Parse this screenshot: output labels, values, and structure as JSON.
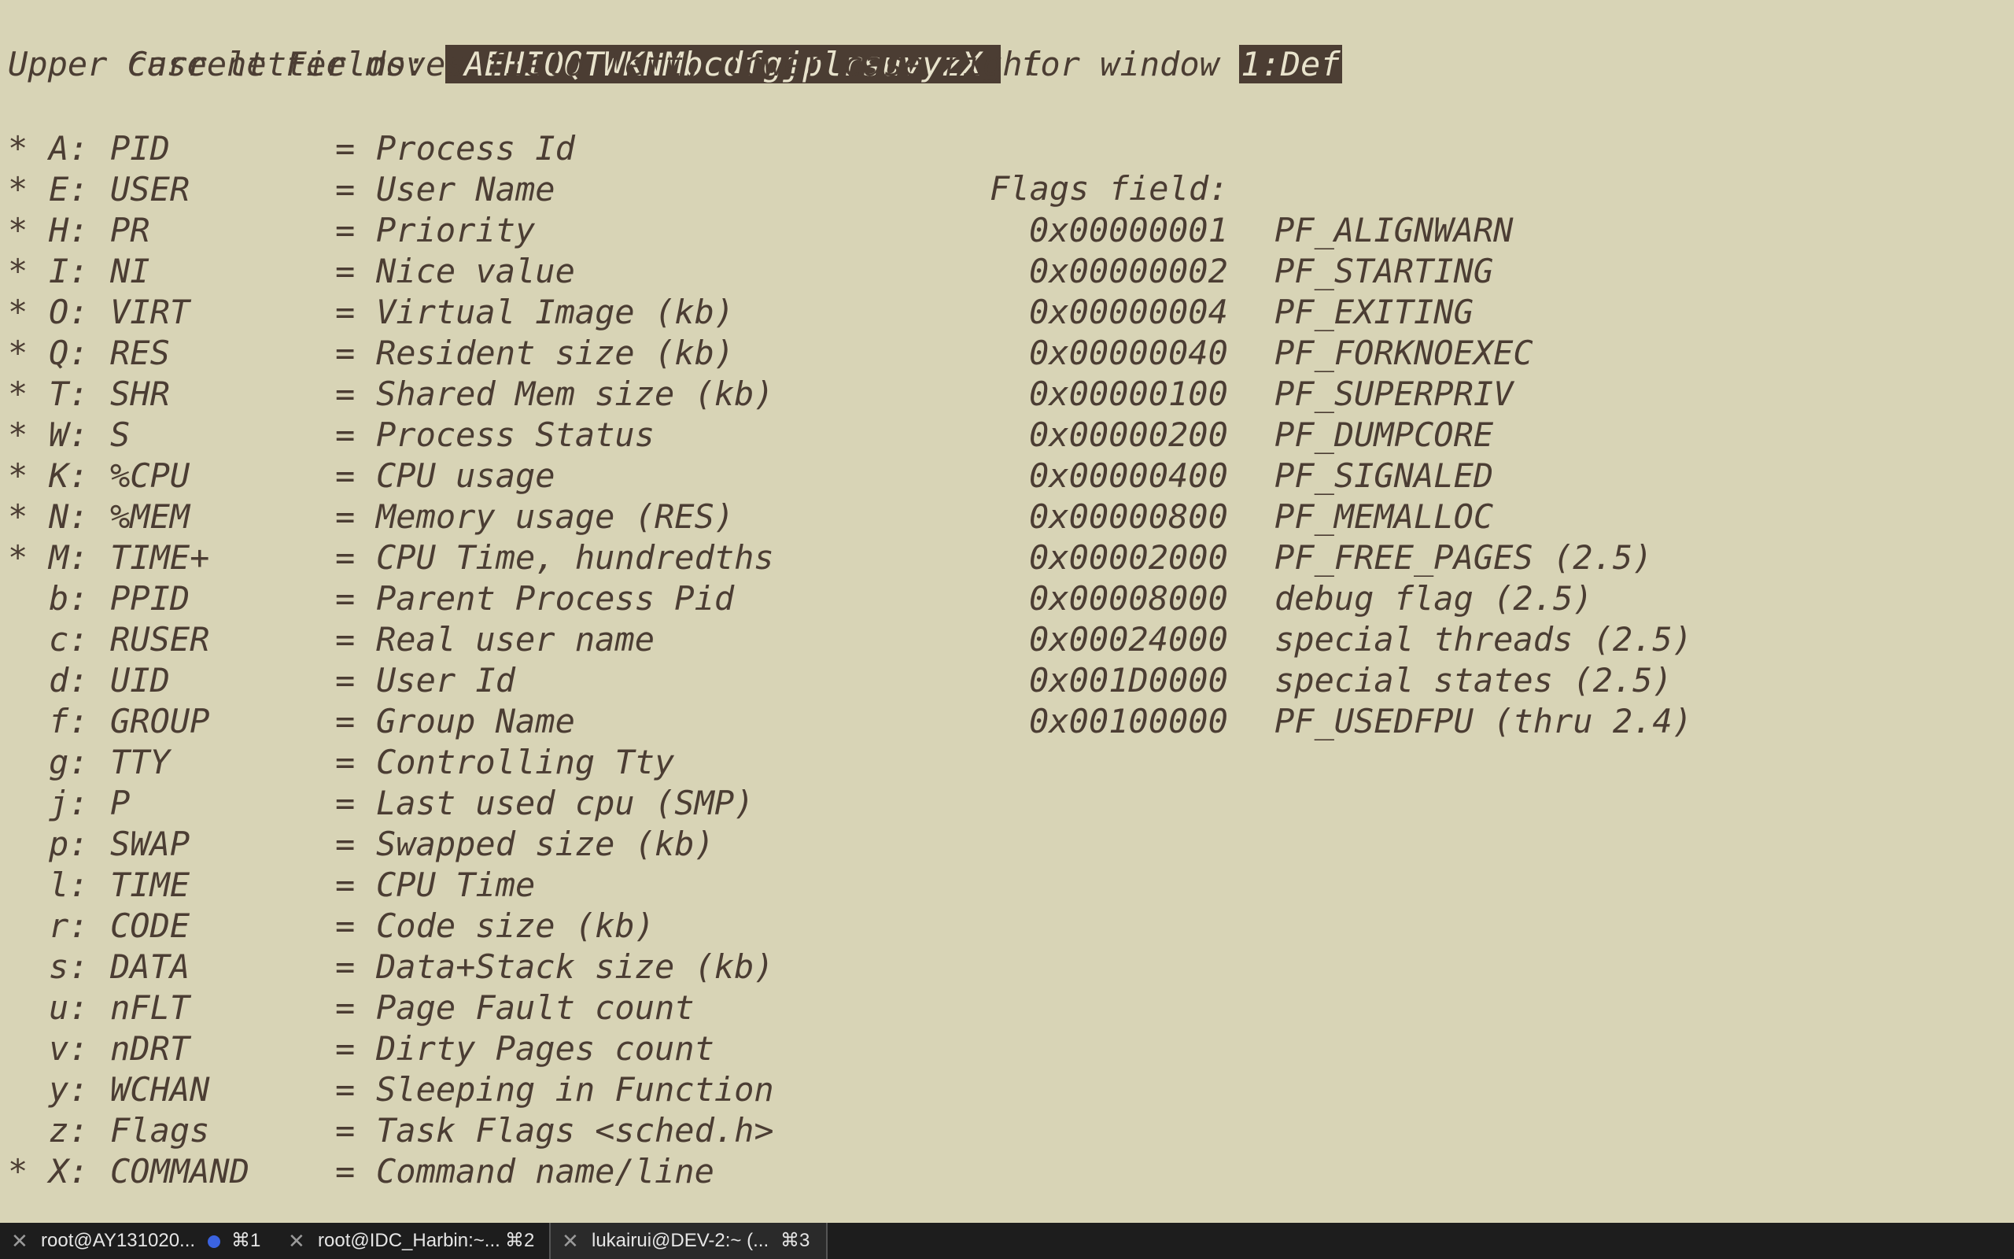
{
  "header": {
    "prefix": "Current Fields: ",
    "fields": "AEHIOQTWKNMbcdfgjplrsuvyzX",
    "middle": " for window ",
    "window": "1:Def",
    "help": "Upper case letter moves field left, lower case right"
  },
  "fields": [
    {
      "star": "*",
      "key": "A:",
      "name": "PID",
      "desc": "Process Id"
    },
    {
      "star": "*",
      "key": "E:",
      "name": "USER",
      "desc": "User Name"
    },
    {
      "star": "*",
      "key": "H:",
      "name": "PR",
      "desc": "Priority"
    },
    {
      "star": "*",
      "key": "I:",
      "name": "NI",
      "desc": "Nice value"
    },
    {
      "star": "*",
      "key": "O:",
      "name": "VIRT",
      "desc": "Virtual Image (kb)"
    },
    {
      "star": "*",
      "key": "Q:",
      "name": "RES",
      "desc": "Resident size (kb)"
    },
    {
      "star": "*",
      "key": "T:",
      "name": "SHR",
      "desc": "Shared Mem size (kb)"
    },
    {
      "star": "*",
      "key": "W:",
      "name": "S",
      "desc": "Process Status"
    },
    {
      "star": "*",
      "key": "K:",
      "name": "%CPU",
      "desc": "CPU usage"
    },
    {
      "star": "*",
      "key": "N:",
      "name": "%MEM",
      "desc": "Memory usage (RES)"
    },
    {
      "star": "*",
      "key": "M:",
      "name": "TIME+",
      "desc": "CPU Time, hundredths"
    },
    {
      "star": "",
      "key": "b:",
      "name": "PPID",
      "desc": "Parent Process Pid"
    },
    {
      "star": "",
      "key": "c:",
      "name": "RUSER",
      "desc": "Real user name"
    },
    {
      "star": "",
      "key": "d:",
      "name": "UID",
      "desc": "User Id"
    },
    {
      "star": "",
      "key": "f:",
      "name": "GROUP",
      "desc": "Group Name"
    },
    {
      "star": "",
      "key": "g:",
      "name": "TTY",
      "desc": "Controlling Tty"
    },
    {
      "star": "",
      "key": "j:",
      "name": "P",
      "desc": "Last used cpu (SMP)"
    },
    {
      "star": "",
      "key": "p:",
      "name": "SWAP",
      "desc": "Swapped size (kb)"
    },
    {
      "star": "",
      "key": "l:",
      "name": "TIME",
      "desc": "CPU Time"
    },
    {
      "star": "",
      "key": "r:",
      "name": "CODE",
      "desc": "Code size (kb)"
    },
    {
      "star": "",
      "key": "s:",
      "name": "DATA",
      "desc": "Data+Stack size (kb)"
    },
    {
      "star": "",
      "key": "u:",
      "name": "nFLT",
      "desc": "Page Fault count"
    },
    {
      "star": "",
      "key": "v:",
      "name": "nDRT",
      "desc": "Dirty Pages count"
    },
    {
      "star": "",
      "key": "y:",
      "name": "WCHAN",
      "desc": "Sleeping in Function"
    },
    {
      "star": "",
      "key": "z:",
      "name": "Flags",
      "desc": "Task Flags <sched.h>"
    },
    {
      "star": "*",
      "key": "X:",
      "name": "COMMAND",
      "desc": "Command name/line"
    }
  ],
  "eq": "=",
  "flags": {
    "title": "Flags field:",
    "items": [
      {
        "hex": "0x00000001",
        "desc": "PF_ALIGNWARN"
      },
      {
        "hex": "0x00000002",
        "desc": "PF_STARTING"
      },
      {
        "hex": "0x00000004",
        "desc": "PF_EXITING"
      },
      {
        "hex": "0x00000040",
        "desc": "PF_FORKNOEXEC"
      },
      {
        "hex": "0x00000100",
        "desc": "PF_SUPERPRIV"
      },
      {
        "hex": "0x00000200",
        "desc": "PF_DUMPCORE"
      },
      {
        "hex": "0x00000400",
        "desc": "PF_SIGNALED"
      },
      {
        "hex": "0x00000800",
        "desc": "PF_MEMALLOC"
      },
      {
        "hex": "0x00002000",
        "desc": "PF_FREE_PAGES (2.5)"
      },
      {
        "hex": "0x00008000",
        "desc": "debug flag (2.5)"
      },
      {
        "hex": "0x00024000",
        "desc": "special threads (2.5)"
      },
      {
        "hex": "0x001D0000",
        "desc": "special states (2.5)"
      },
      {
        "hex": "0x00100000",
        "desc": "PF_USEDFPU (thru 2.4)"
      }
    ]
  },
  "tabs": [
    {
      "close": "✕",
      "title": "root@AY131020...",
      "shortcut": "⌘1",
      "has_dot": true
    },
    {
      "close": "✕",
      "title": "root@IDC_Harbin:~...",
      "shortcut": "⌘2",
      "has_dot": false
    },
    {
      "close": "✕",
      "title": "lukairui@DEV-2:~ (...",
      "shortcut": "⌘3",
      "has_dot": false
    }
  ],
  "colors": {
    "background": "#d8d4b6",
    "foreground": "#4b3d33",
    "highlight_bg": "#4b3d33",
    "highlight_fg": "#e8e3cc",
    "tabbar_bg": "#1d1d1d",
    "tab_dot": "#3b63e0"
  }
}
